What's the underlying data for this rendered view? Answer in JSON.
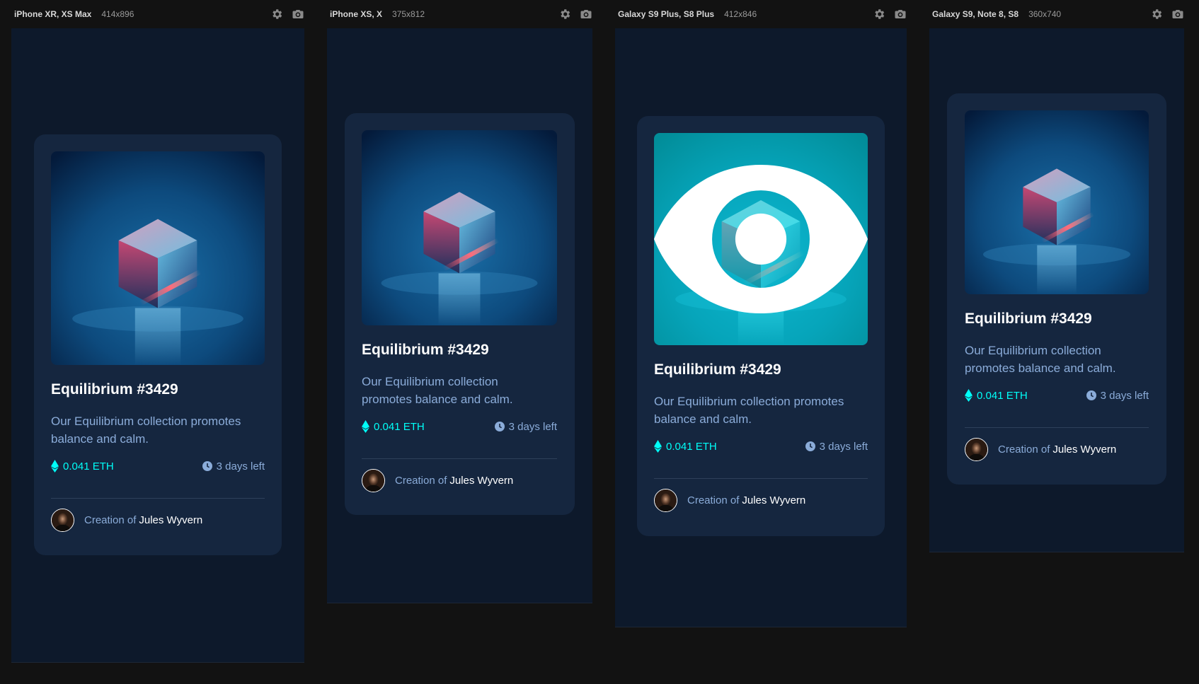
{
  "devices": [
    {
      "name": "iPhone XR, XS Max",
      "size": "414x896"
    },
    {
      "name": "iPhone XS, X",
      "size": "375x812"
    },
    {
      "name": "Galaxy S9 Plus, S8 Plus",
      "size": "412x846"
    },
    {
      "name": "Galaxy S9, Note 8, S8",
      "size": "360x740"
    }
  ],
  "card": {
    "title": "Equilibrium #3429",
    "description": "Our Equilibrium collection promotes balance and calm.",
    "price": "0.041 ETH",
    "time_left": "3 days left",
    "creator_prefix": "Creation of",
    "creator_name": "Jules Wyvern"
  },
  "icons": {
    "settings": "gear-icon",
    "screenshot": "camera-icon",
    "price": "ethereum-icon",
    "time": "clock-icon",
    "hover": "eye-icon"
  },
  "colors": {
    "page_bg": "#0d192b",
    "card_bg": "#15263f",
    "cyan": "#00fff8",
    "soft_blue": "#8bacd9",
    "white": "#ffffff"
  }
}
